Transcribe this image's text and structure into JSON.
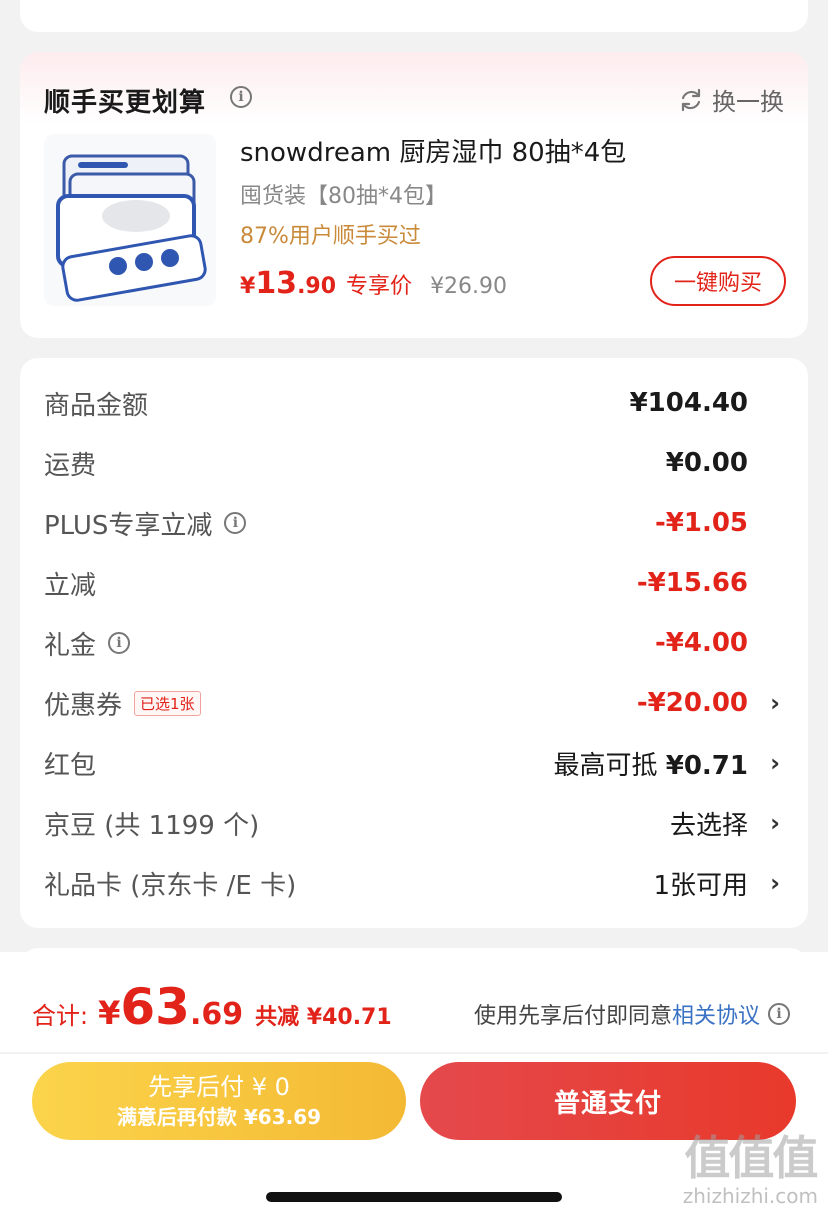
{
  "top_card": {
    "cut_text": ""
  },
  "addon": {
    "title": "顺手买更划算",
    "swap_label": "换一换",
    "product": {
      "name": "snowdream 厨房湿巾 80抽*4包",
      "spec": "囤货装【80抽*4包】",
      "buyers": "87%用户顺手买过",
      "price_yen": "¥",
      "price_int": "13",
      "price_dec": ".90",
      "price_tag": "专享价",
      "original_price": "¥26.90"
    },
    "buy_button": "一键购买"
  },
  "summary": {
    "rows": [
      {
        "label": "商品金额",
        "value": "¥104.40"
      },
      {
        "label": "运费",
        "value": "¥0.00"
      },
      {
        "label": "PLUS专享立减",
        "value": "-¥1.05"
      },
      {
        "label": "立减",
        "value": "-¥15.66"
      },
      {
        "label": "礼金",
        "value": "-¥4.00"
      },
      {
        "label": "优惠券",
        "badge": "已选1张",
        "value": "-¥20.00"
      },
      {
        "label": "红包",
        "value_prefix": "最高可抵",
        "value": "¥0.71"
      },
      {
        "label": "京豆 (共 1199 个)",
        "value": "去选择"
      },
      {
        "label": "礼品卡 (京东卡 /E 卡)",
        "value": "1张可用"
      }
    ]
  },
  "bottom": {
    "total_label": "合计:",
    "total_yen": "¥",
    "total_int": "63",
    "total_dec": ".69",
    "total_saved": "共减 ¥40.71",
    "agree_text": "使用先享后付即同意",
    "agree_link": "相关协议",
    "later_line1": "先享后付 ¥ 0",
    "later_line2": "满意后再付款 ¥63.69",
    "pay_button": "普通支付"
  },
  "watermark": {
    "glyphs": "值值值",
    "domain": "zhizhizhi.com"
  },
  "colors": {
    "accent_red": "#e2231a",
    "gold": "#f4b934",
    "link_blue": "#3a72c4"
  }
}
